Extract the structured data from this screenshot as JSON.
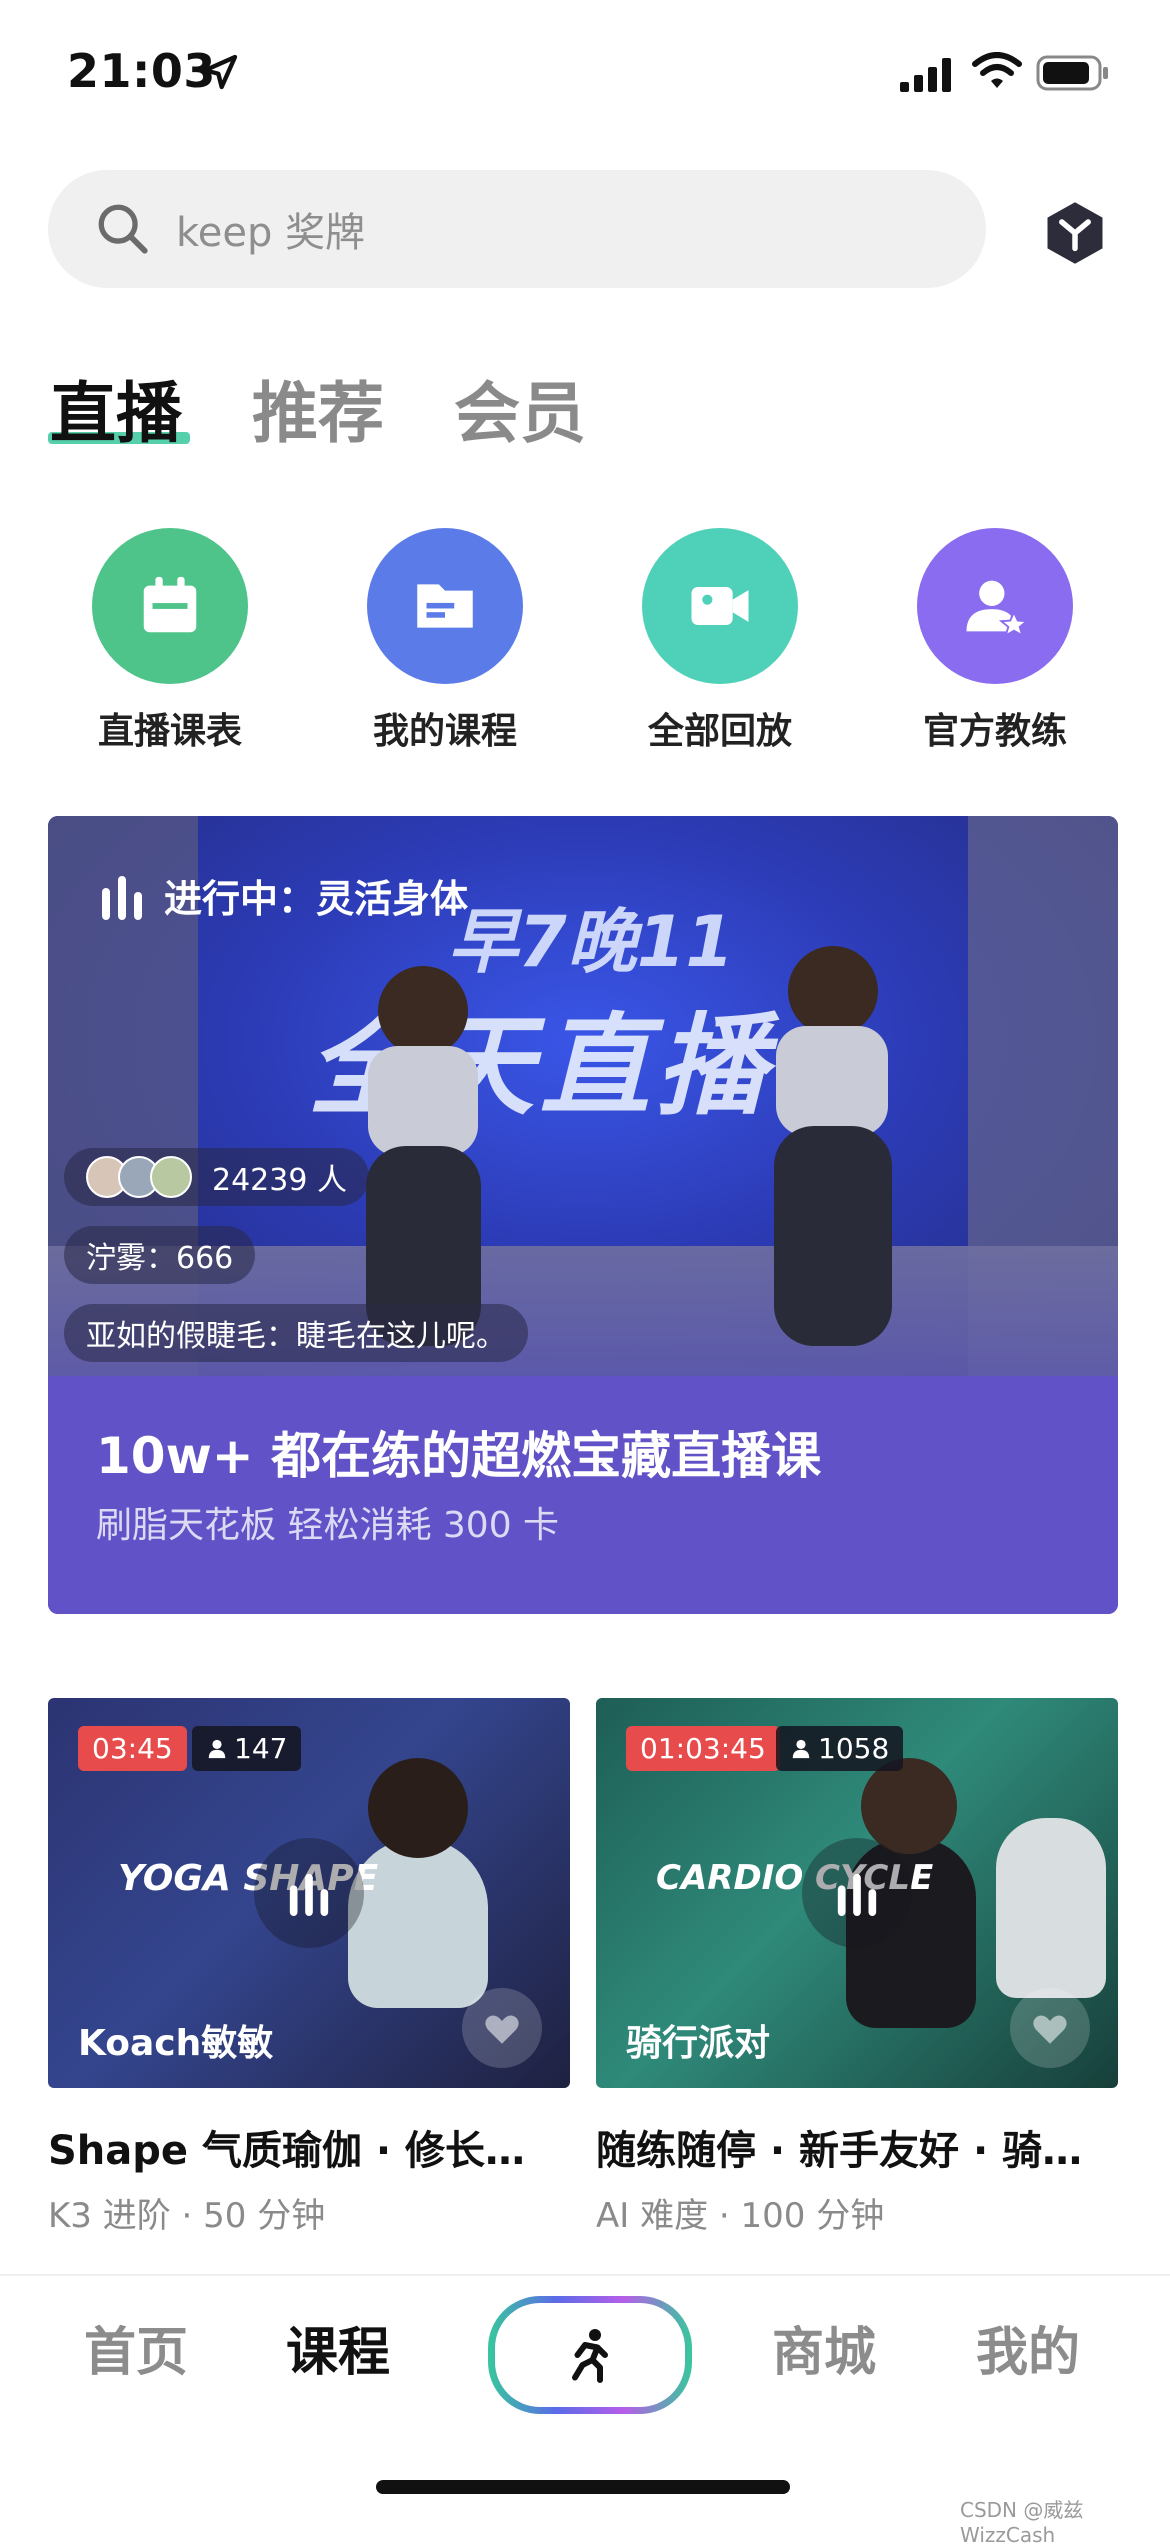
{
  "status_bar": {
    "time": "21:03"
  },
  "search": {
    "placeholder": "keep 奖牌"
  },
  "tabs": [
    {
      "label": "直播",
      "active": true
    },
    {
      "label": "推荐",
      "active": false
    },
    {
      "label": "会员",
      "active": false
    }
  ],
  "quick_actions": [
    {
      "label": "直播课表",
      "color": "#4fc48a",
      "icon": "calendar-icon"
    },
    {
      "label": "我的课程",
      "color": "#5b7be8",
      "icon": "folder-icon"
    },
    {
      "label": "全部回放",
      "color": "#4fd0b8",
      "icon": "video-camera-icon"
    },
    {
      "label": "官方教练",
      "color": "#8a6cf0",
      "icon": "coach-star-icon"
    }
  ],
  "hero": {
    "live_label": "进行中：灵活身体",
    "viewers": "24239 人",
    "comment_1": "泞雾：666",
    "comment_2": "亚如的假睫毛：睫毛在这儿呢。",
    "title": "10w+ 都在练的超燃宝藏直播课",
    "subtitle": "刷脂天花板 轻松消耗 300 卡",
    "banner_text": "全天直播",
    "banner_sub": "早7晚11"
  },
  "cards": [
    {
      "time": "03:45",
      "count": "147",
      "coach": "Koach敏敏",
      "title": "Shape 气质瑜伽 · 修长…",
      "meta": "K3 进阶 · 50 分钟"
    },
    {
      "time": "01:03:45",
      "count": "1058",
      "coach": "骑行派对",
      "title": "随练随停 · 新手友好 · 骑…",
      "meta": "AI 难度 · 100 分钟"
    }
  ],
  "bottom_nav": [
    {
      "label": "首页",
      "active": false
    },
    {
      "label": "课程",
      "active": true
    },
    {
      "label": "商城",
      "active": false
    },
    {
      "label": "我的",
      "active": false
    }
  ],
  "watermark": "CSDN @威兹WizzCash"
}
